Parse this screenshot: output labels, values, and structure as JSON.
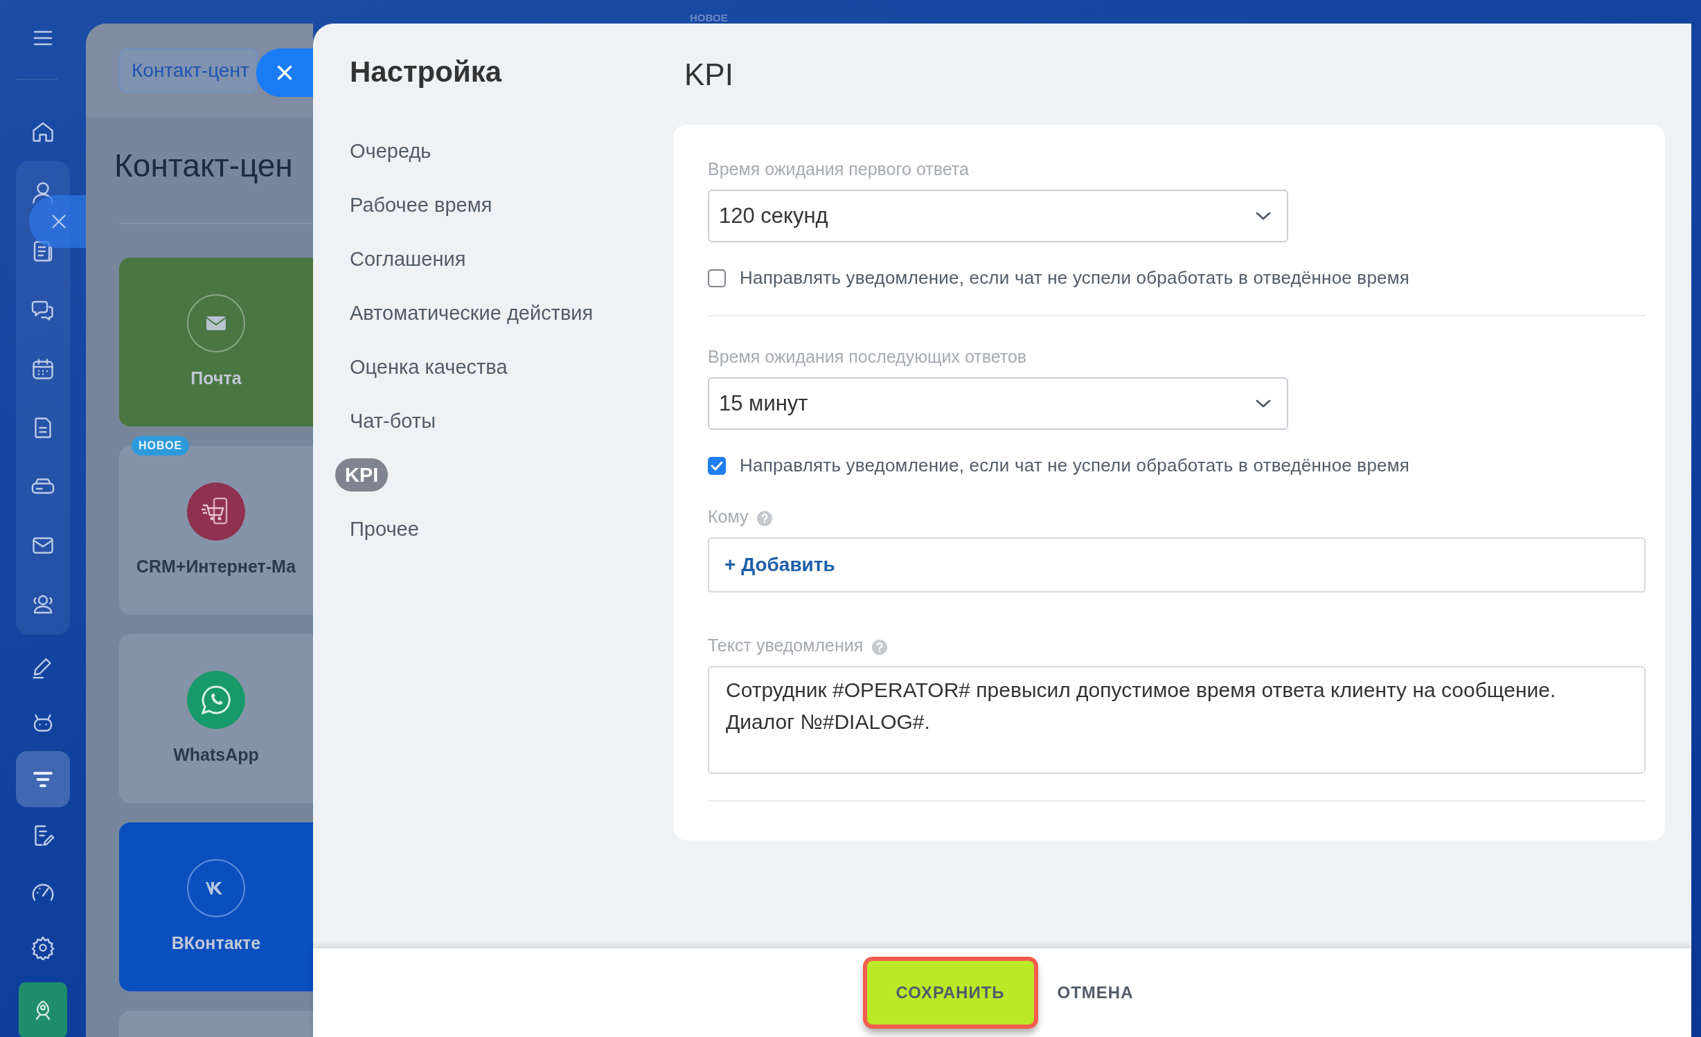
{
  "top_label": "НОВОЕ",
  "nav": {
    "items": [
      {
        "selected": false
      },
      {
        "selected": false
      },
      {
        "selected": false
      },
      {
        "selected": false
      },
      {
        "selected": false
      },
      {
        "selected": false
      },
      {
        "selected": false
      },
      {
        "selected": false
      },
      {
        "selected": false
      },
      {
        "selected": false
      },
      {
        "selected": false
      },
      {
        "selected": false
      },
      {
        "selected": true
      },
      {
        "selected": false
      },
      {
        "selected": false
      },
      {
        "selected": false
      },
      {
        "selected": false
      }
    ]
  },
  "background_page": {
    "breadcrumb": "Контакт-цент",
    "title": "Контакт-цен",
    "cards": [
      {
        "label": "Почта",
        "color": "#4a7641"
      },
      {
        "label": "CRM+Интернет-Ма",
        "color": "#8593a8",
        "badge": "НОВОЕ"
      },
      {
        "label": "WhatsApp",
        "color": "#8593a8"
      },
      {
        "label": "ВКонтакте",
        "color": "#0b4fbf"
      }
    ]
  },
  "settings": {
    "title": "Настройка",
    "menu": [
      {
        "label": "Очередь",
        "selected": false
      },
      {
        "label": "Рабочее время",
        "selected": false
      },
      {
        "label": "Соглашения",
        "selected": false
      },
      {
        "label": "Автоматические действия",
        "selected": false
      },
      {
        "label": "Оценка качества",
        "selected": false
      },
      {
        "label": "Чат-боты",
        "selected": false
      },
      {
        "label": "KPI",
        "selected": true
      },
      {
        "label": "Прочее",
        "selected": false
      }
    ]
  },
  "kpi": {
    "title": "KPI",
    "first_reply": {
      "label": "Время ожидания первого ответа",
      "value": "120 секунд",
      "notify": {
        "label": "Направлять уведомление, если чат не успели обработать в отведённое время",
        "checked": false
      }
    },
    "next_reply": {
      "label": "Время ожидания последующих ответов",
      "value": "15 минут",
      "notify": {
        "label": "Направлять уведомление, если чат не успели обработать в отведённое время",
        "checked": true
      }
    },
    "recipients": {
      "label": "Кому",
      "add_link": "+ Добавить"
    },
    "notification_text": {
      "label": "Текст уведомления",
      "value": "Сотрудник #OPERATOR# превысил допустимое время ответа клиенту на сообщение.\nДиалог №#DIALOG#."
    }
  },
  "footer": {
    "buttons": [
      {
        "label": "СОХРАНИТЬ",
        "kind": "primary",
        "highlighted": true
      },
      {
        "label": "ОТМЕНА",
        "kind": "link",
        "highlighted": false
      }
    ]
  }
}
